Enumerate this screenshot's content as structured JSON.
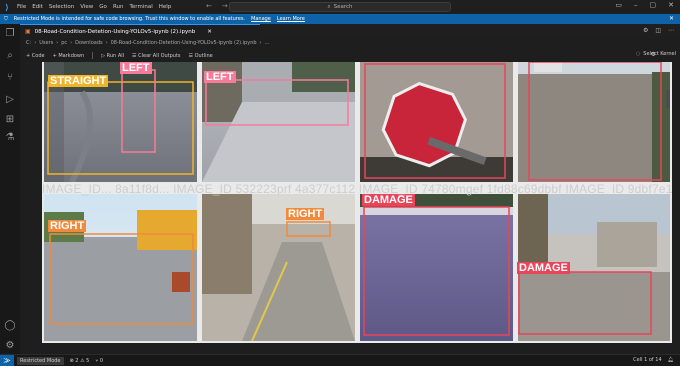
{
  "menu": [
    "File",
    "Edit",
    "Selection",
    "View",
    "Go",
    "Run",
    "Terminal",
    "Help"
  ],
  "search": {
    "label": "Search"
  },
  "restricted": {
    "message": "Restricted Mode is intended for safe code browsing. Trust this window to enable all features.",
    "manage": "Manage",
    "learn_more": "Learn More"
  },
  "tab": {
    "title": "08-Road-Condition-Detetion-Using-YOLOv5-ipynb (2).ipynb"
  },
  "breadcrumb": [
    "C:",
    "Users",
    "pc",
    "Downloads",
    "08-Road-Condition-Detetion-Using-YOLOv5-ipynb (2).ipynb",
    "..."
  ],
  "toolbar": {
    "code": "+ Code",
    "markdown": "+ Markdown",
    "run_all": "Run All",
    "clear_outputs": "Clear All Outputs",
    "outline": "Outline",
    "select_kernel": "Select Kernel"
  },
  "images": [
    {
      "labels": [
        {
          "text": "STRAIGHT",
          "color": "#f0b429"
        },
        {
          "text": "LEFT",
          "color": "#f47c9a"
        }
      ]
    },
    {
      "labels": [
        {
          "text": "LEFT",
          "color": "#f47c9a"
        }
      ]
    },
    {
      "labels": []
    },
    {
      "labels": []
    },
    {
      "labels": [
        {
          "text": "RIGHT",
          "color": "#f08a3c"
        }
      ]
    },
    {
      "labels": [
        {
          "text": "RIGHT",
          "color": "#f08a3c"
        }
      ]
    },
    {
      "labels": [
        {
          "text": "DAMAGE",
          "color": "#e8455b"
        }
      ]
    },
    {
      "labels": [
        {
          "text": "DAMAGE",
          "color": "#e8455b"
        }
      ]
    }
  ],
  "id_overlay": "IMAGE_ID... 8a11f8d... IMAGE_ID 532223prf 4a377c112 IMAGE_ID 74780mgef 1fd88c69dbbf IMAGE_ID 9dbf7e18 c",
  "status": {
    "restricted_mode": "Restricted Mode",
    "problems": "⊗ 2 ⚠ 5",
    "ports": "⑂ 0",
    "cell": "Cell 1 of 14"
  },
  "colors": {
    "accent": "#0e63a8",
    "tab_border": "#3794ff"
  }
}
